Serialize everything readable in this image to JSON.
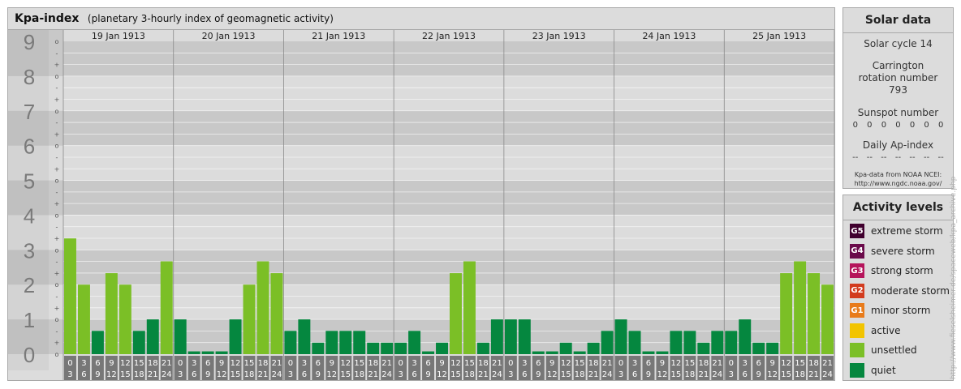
{
  "header": {
    "title": "Kpa-index",
    "subtitle": "(planetary 3-hourly index of geomagnetic activity)"
  },
  "chart_data": {
    "type": "bar",
    "title": "Kpa-index",
    "subtitle": "(planetary 3-hourly index of geomagnetic activity)",
    "ylim": [
      0,
      9
    ],
    "y_ticks": [
      "0",
      "1",
      "2",
      "3",
      "4",
      "5",
      "6",
      "7",
      "8",
      "9"
    ],
    "sub_ticks": [
      "o",
      "+",
      "-"
    ],
    "days": [
      "19 Jan 1913",
      "20 Jan 1913",
      "21 Jan 1913",
      "22 Jan 1913",
      "23 Jan 1913",
      "24 Jan 1913",
      "25 Jan 1913"
    ],
    "interval_starts": [
      "0",
      "3",
      "6",
      "9",
      "12",
      "15",
      "18",
      "21"
    ],
    "interval_ends": [
      "3",
      "6",
      "9",
      "12",
      "15",
      "18",
      "21",
      "24"
    ],
    "values": [
      [
        3.33,
        2,
        0.67,
        2.33,
        2,
        0.67,
        1,
        2.67
      ],
      [
        1,
        0,
        0,
        0,
        1,
        2,
        2.67,
        2.33
      ],
      [
        0.67,
        1,
        0.33,
        0.67,
        0.67,
        0.67,
        0.33,
        0.33
      ],
      [
        0.33,
        0.67,
        0,
        0.33,
        2.33,
        2.67,
        0.33,
        1
      ],
      [
        1,
        1,
        0,
        0,
        0.33,
        0,
        0.33,
        0.67
      ],
      [
        1,
        0.67,
        0,
        0,
        0.67,
        0.67,
        0.33,
        0.67
      ],
      [
        0.67,
        1,
        0.33,
        0.33,
        2.33,
        2.67,
        2.33,
        2
      ]
    ],
    "colors": {
      "quiet": "#05873f",
      "unsettled": "#7bbf26",
      "active": "#f2c400",
      "minor": "#e87b1a",
      "moderate": "#d23b1e",
      "strong": "#b5145b",
      "severe": "#6a0a4a",
      "extreme": "#40002e"
    }
  },
  "solar": {
    "header": "Solar data",
    "cycle": "Solar cycle 14",
    "carrington": "Carrington rotation number 793",
    "sunspot_label": "Sunspot number",
    "sunspot_values": [
      "0",
      "0",
      "0",
      "0",
      "0",
      "0",
      "0"
    ],
    "ap_label": "Daily Ap-index",
    "ap_values": [
      "--",
      "--",
      "--",
      "--",
      "--",
      "--",
      "--"
    ],
    "source_line1": "Kpa-data from NOAA NCEI:",
    "source_line2": "http://www.ngdc.noaa.gov/"
  },
  "legend": {
    "header": "Activity levels",
    "items": [
      {
        "code": "G5",
        "label": "extreme storm",
        "color": "#40002e"
      },
      {
        "code": "G4",
        "label": "severe storm",
        "color": "#6a0a4a"
      },
      {
        "code": "G3",
        "label": "strong storm",
        "color": "#b5145b"
      },
      {
        "code": "G2",
        "label": "moderate storm",
        "color": "#d23b1e"
      },
      {
        "code": "G1",
        "label": "minor storm",
        "color": "#e87b1a"
      },
      {
        "code": "",
        "label": "active",
        "color": "#f2c400"
      },
      {
        "code": "",
        "label": "unsettled",
        "color": "#7bbf26"
      },
      {
        "code": "",
        "label": "quiet",
        "color": "#05873f"
      }
    ]
  },
  "watermark": "http://www.fieselsheimer.de/spaceweb/kpa_archive.php"
}
